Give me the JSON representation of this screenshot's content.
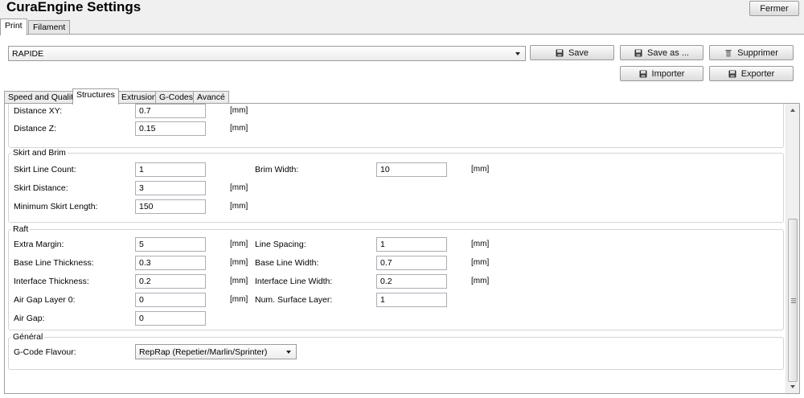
{
  "window": {
    "title": "CuraEngine Settings",
    "close_label": "Fermer"
  },
  "top_tabs": [
    {
      "label": "Print"
    },
    {
      "label": "Filament"
    }
  ],
  "profile": {
    "selected": "RAPIDE"
  },
  "buttons": {
    "save": "Save",
    "save_as": "Save as ...",
    "delete": "Supprimer",
    "import": "Importer",
    "export": "Exporter"
  },
  "sub_tabs": [
    {
      "label": "Speed and Quality"
    },
    {
      "label": "Structures"
    },
    {
      "label": "Extrusion"
    },
    {
      "label": "G-Codes"
    },
    {
      "label": "Avancé"
    }
  ],
  "support": {
    "distance_xy": {
      "label": "Distance XY:",
      "value": "0.7",
      "unit": "[mm]"
    },
    "distance_z": {
      "label": "Distance Z:",
      "value": "0.15",
      "unit": "[mm]"
    }
  },
  "skirt": {
    "title": "Skirt and Brim",
    "line_count": {
      "label": "Skirt Line Count:",
      "value": "1"
    },
    "brim_width": {
      "label": "Brim Width:",
      "value": "10",
      "unit": "[mm]"
    },
    "distance": {
      "label": "Skirt Distance:",
      "value": "3",
      "unit": "[mm]"
    },
    "min_length": {
      "label": "Minimum Skirt Length:",
      "value": "150",
      "unit": "[mm]"
    }
  },
  "raft": {
    "title": "Raft",
    "extra_margin": {
      "label": "Extra Margin:",
      "value": "5",
      "unit": "[mm]"
    },
    "line_spacing": {
      "label": "Line Spacing:",
      "value": "1",
      "unit": "[mm]"
    },
    "base_line_thickness": {
      "label": "Base Line Thickness:",
      "value": "0.3",
      "unit": "[mm]"
    },
    "base_line_width": {
      "label": "Base Line Width:",
      "value": "0.7",
      "unit": "[mm]"
    },
    "interface_thickness": {
      "label": "Interface Thickness:",
      "value": "0.2",
      "unit": "[mm]"
    },
    "interface_line_width": {
      "label": "Interface Line Width:",
      "value": "0.2",
      "unit": "[mm]"
    },
    "air_gap_layer0": {
      "label": "Air Gap Layer 0:",
      "value": "0",
      "unit": "[mm]"
    },
    "num_surface_layer": {
      "label": "Num. Surface Layer:",
      "value": "1"
    },
    "air_gap": {
      "label": "Air Gap:",
      "value": "0"
    }
  },
  "general": {
    "title": "Général",
    "gcode_flavour": {
      "label": "G-Code Flavour:",
      "value": "RepRap (Repetier/Marlin/Sprinter)"
    }
  }
}
